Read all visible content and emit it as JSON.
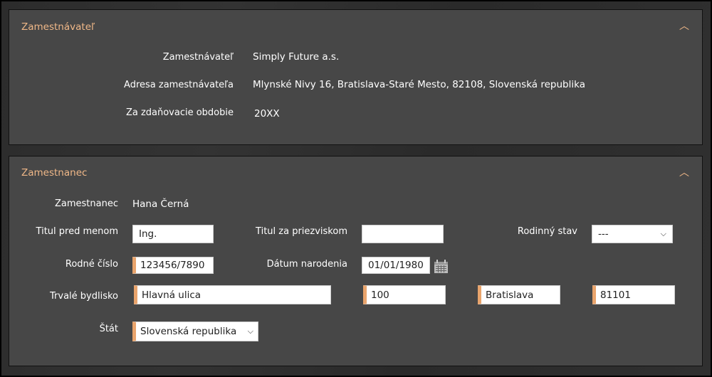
{
  "employer": {
    "title": "Zamestnávateľ",
    "fields": [
      {
        "label": "Zamestnávateľ",
        "value": "Simply Future a.s."
      },
      {
        "label": "Adresa zamestnávateľa",
        "value": "Mlynské Nivy 16, Bratislava-Staré Mesto, 82108, Slovenská republika"
      },
      {
        "label": "Za zdaňovacie obdobie",
        "value": "20XX"
      }
    ]
  },
  "employee": {
    "title": "Zamestnanec",
    "name_label": "Zamestnanec",
    "name_value": "Hana Černá",
    "title_before_label": "Titul pred menom",
    "title_before_value": "Ing.",
    "title_after_label": "Titul za priezviskom",
    "title_after_value": "",
    "marital_label": "Rodinný stav",
    "marital_value": "---",
    "birth_number_label": "Rodné číslo",
    "birth_number_value": "123456/7890",
    "birth_date_label": "Dátum narodenia",
    "birth_date_value": "01/01/1980",
    "address_label": "Trvalé bydlisko",
    "street": "Hlavná ulica",
    "number": "100",
    "city": "Bratislava",
    "zip": "81101",
    "country_label": "Štát",
    "country_value": "Slovenská republika"
  },
  "icons": {
    "collapse": "chevron-up-icon",
    "calendar": "calendar-icon",
    "dropdown": "chevron-down-icon"
  }
}
